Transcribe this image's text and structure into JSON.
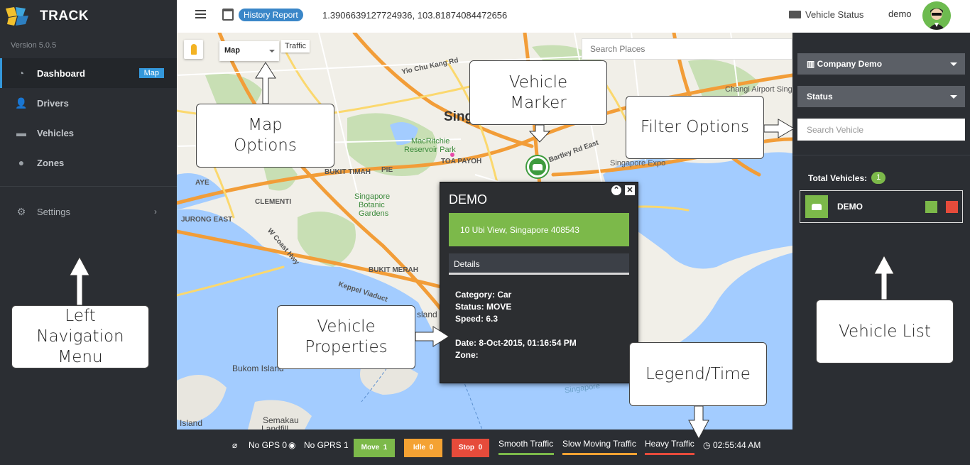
{
  "brand": {
    "name": "TRACK",
    "version": "Version 5.0.5"
  },
  "nav": {
    "items": [
      {
        "label": "Dashboard",
        "badge": "Map"
      },
      {
        "label": "Drivers"
      },
      {
        "label": "Vehicles"
      },
      {
        "label": "Zones"
      }
    ],
    "settings": "Settings"
  },
  "header": {
    "history_label": "History Report",
    "coordinates": "1.3906639127724936, 103.81874084472656",
    "vehicle_status": "Vehicle Status",
    "username": "demo"
  },
  "map": {
    "type_select": "Map",
    "traffic_button": "Traffic",
    "search_placeholder": "Search Places",
    "labels": {
      "city": "Sing",
      "macritchie": "MacRitchie",
      "reservoir": "Reservoir Park",
      "toa_payoh": "TOA PAYOH",
      "bukit_timah": "BUKIT TIMAH",
      "botanic1": "Singapore",
      "botanic2": "Botanic",
      "botanic3": "Gardens",
      "clementi": "CLEMENTI",
      "jurong_east": "JURONG EAST",
      "coast_hwy": "W Coast Hwy",
      "bukit_merah": "BUKIT MERAH",
      "keppel": "Keppel Viaduct",
      "bukom": "Bukom Island",
      "semakau": "Semakau",
      "semakau2": "Landfill",
      "island": "Island",
      "island2": "sland",
      "changi": "Changi Airport Sing",
      "expo": "Singapore Expo",
      "bartley": "Bartley Rd East",
      "yio_chu": "Yio Chu Kang Rd",
      "aye": "AYE",
      "pie": "PIE",
      "singapore_sea": "Singapore"
    }
  },
  "popup": {
    "title": "DEMO",
    "address": "10 Ubi View, Singapore 408543",
    "details_label": "Details",
    "category": "Category: Car",
    "status": "Status: MOVE",
    "speed": "Speed: 6.3",
    "date": "Date:  8-Oct-2015, 01:16:54 PM",
    "zone": "Zone:"
  },
  "callouts": {
    "map_options": "Map\nOptions",
    "vehicle_marker": "Vehicle\nMarker",
    "filter_options": "Filter Options",
    "left_nav": "Left\nNavigation\nMenu",
    "vehicle_properties": "Vehicle\nProperties",
    "legend_time": "Legend/Time",
    "vehicle_list": "Vehicle List"
  },
  "right_panel": {
    "company_select": "Company Demo",
    "status_select": "Status",
    "search_placeholder": "Search Vehicle",
    "total_label": "Total Vehicles:",
    "total_count": "1",
    "vehicle_name": "DEMO"
  },
  "legend": {
    "no_gps": "No GPS 0",
    "no_gprs": "No GPRS 1",
    "move": "Move",
    "move_count": "1",
    "idle": "Idle",
    "idle_count": "0",
    "stop": "Stop",
    "stop_count": "0",
    "smooth": "Smooth Traffic",
    "slow": "Slow Moving Traffic",
    "heavy": "Heavy Traffic",
    "time": "02:55:44 AM"
  },
  "colors": {
    "move": "#7cb94a",
    "idle": "#f4a233",
    "stop": "#e64b3b",
    "accent": "#3498db"
  }
}
